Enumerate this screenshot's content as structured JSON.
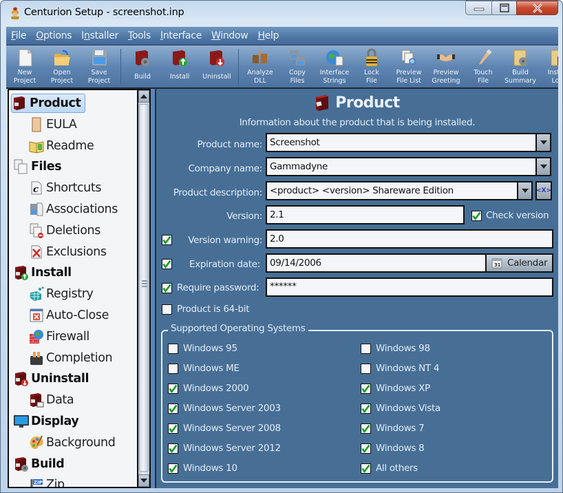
{
  "window": {
    "title": "Centurion Setup - screenshot.inp"
  },
  "menu": {
    "items": [
      {
        "label": "File",
        "accel": "F",
        "rest": "ile"
      },
      {
        "label": "Options",
        "accel": "O",
        "rest": "ptions"
      },
      {
        "label": "Installer",
        "pre": "I",
        "accel": "n",
        "rest": "staller"
      },
      {
        "label": "Tools",
        "accel": "T",
        "rest": "ools"
      },
      {
        "label": "Interface",
        "accel": "I",
        "rest": "nterface"
      },
      {
        "label": "Window",
        "accel": "W",
        "rest": "indow"
      },
      {
        "label": "Help",
        "accel": "H",
        "rest": "elp"
      }
    ]
  },
  "toolbar": {
    "buttons": [
      {
        "label": "New\nProject",
        "icon": "new-project-icon"
      },
      {
        "label": "Open\nProject",
        "icon": "open-project-icon"
      },
      {
        "label": "Save\nProject",
        "icon": "save-project-icon"
      },
      {
        "label": "Build",
        "icon": "build-icon"
      },
      {
        "label": "Install",
        "icon": "install-icon"
      },
      {
        "label": "Uninstall",
        "icon": "uninstall-icon"
      },
      {
        "label": "Analyze\nDLL",
        "icon": "analyze-dll-icon"
      },
      {
        "label": "Copy\nFiles",
        "icon": "copy-files-icon"
      },
      {
        "label": "Interface\nStrings",
        "icon": "interface-strings-icon"
      },
      {
        "label": "Lock\nFile",
        "icon": "lock-file-icon"
      },
      {
        "label": "Preview\nFile List",
        "icon": "preview-file-list-icon"
      },
      {
        "label": "Preview\nGreeting",
        "icon": "preview-greeting-icon"
      },
      {
        "label": "Touch\nFile",
        "icon": "touch-file-icon"
      },
      {
        "label": "Build\nSummary",
        "icon": "build-summary-icon"
      },
      {
        "label": "Install\nLog",
        "icon": "install-log-icon"
      }
    ]
  },
  "sidebar": {
    "items": [
      {
        "label": "Product",
        "level": 0,
        "selected": true,
        "icon": "product-box-icon"
      },
      {
        "label": "EULA",
        "level": 1,
        "icon": "scroll-icon"
      },
      {
        "label": "Readme",
        "level": 1,
        "icon": "open-book-icon"
      },
      {
        "label": "Files",
        "level": 0,
        "icon": "files-icon"
      },
      {
        "label": "Shortcuts",
        "level": 1,
        "icon": "shortcut-icon"
      },
      {
        "label": "Associations",
        "level": 1,
        "icon": "associations-icon"
      },
      {
        "label": "Deletions",
        "level": 1,
        "icon": "deletions-icon"
      },
      {
        "label": "Exclusions",
        "level": 1,
        "icon": "exclusions-icon"
      },
      {
        "label": "Install",
        "level": 0,
        "icon": "install-box-icon"
      },
      {
        "label": "Registry",
        "level": 1,
        "icon": "registry-icon"
      },
      {
        "label": "Auto-Close",
        "level": 1,
        "icon": "auto-close-icon"
      },
      {
        "label": "Firewall",
        "level": 1,
        "icon": "firewall-icon"
      },
      {
        "label": "Completion",
        "level": 1,
        "icon": "toaster-icon"
      },
      {
        "label": "Uninstall",
        "level": 0,
        "icon": "uninstall-box-icon"
      },
      {
        "label": "Data",
        "level": 1,
        "icon": "data-icon"
      },
      {
        "label": "Display",
        "level": 0,
        "icon": "monitor-icon"
      },
      {
        "label": "Background",
        "level": 1,
        "icon": "palette-icon"
      },
      {
        "label": "Build",
        "level": 0,
        "icon": "build-box-icon"
      },
      {
        "label": "Zip",
        "level": 1,
        "icon": "zip-icon"
      }
    ]
  },
  "page": {
    "title": "Product",
    "subtitle": "Information about the product that is being installed.",
    "fields": {
      "product_name": {
        "label": "Product name:",
        "value": "Screenshot"
      },
      "company_name": {
        "label": "Company name:",
        "value": "Gammadyne"
      },
      "product_description": {
        "label": "Product description:",
        "value": "<product> <version> Shareware Edition",
        "var_button": "<X>"
      },
      "version": {
        "label": "Version:",
        "value": "2.1"
      },
      "check_version": {
        "label": "Check version",
        "checked": true
      },
      "version_warning": {
        "label": "Version warning:",
        "value": "2.0",
        "checked": true
      },
      "expiration_date": {
        "label": "Expiration date:",
        "value": "09/14/2006",
        "checked": true,
        "calendar_label": "Calendar"
      },
      "require_password": {
        "label": "Require password:",
        "value": "******",
        "checked": true
      },
      "product_64bit": {
        "label": "Product is 64-bit",
        "checked": false
      }
    },
    "os_group": {
      "title": "Supported Operating Systems",
      "left": [
        {
          "label": "Windows 95",
          "checked": false
        },
        {
          "label": "Windows ME",
          "checked": false
        },
        {
          "label": "Windows 2000",
          "checked": true
        },
        {
          "label": "Windows Server 2003",
          "checked": true
        },
        {
          "label": "Windows Server 2008",
          "checked": true
        },
        {
          "label": "Windows Server 2012",
          "checked": true
        },
        {
          "label": "Windows 10",
          "checked": true
        }
      ],
      "right": [
        {
          "label": "Windows 98",
          "checked": false
        },
        {
          "label": "Windows NT 4",
          "checked": false
        },
        {
          "label": "Windows XP",
          "checked": true
        },
        {
          "label": "Windows Vista",
          "checked": true
        },
        {
          "label": "Windows 7",
          "checked": true
        },
        {
          "label": "Windows 8",
          "checked": true
        },
        {
          "label": "All others",
          "checked": true
        }
      ]
    }
  },
  "colors": {
    "content_bg": "#476f96",
    "check_green": "#1f9a2a",
    "selection": "#bdd8f6"
  }
}
